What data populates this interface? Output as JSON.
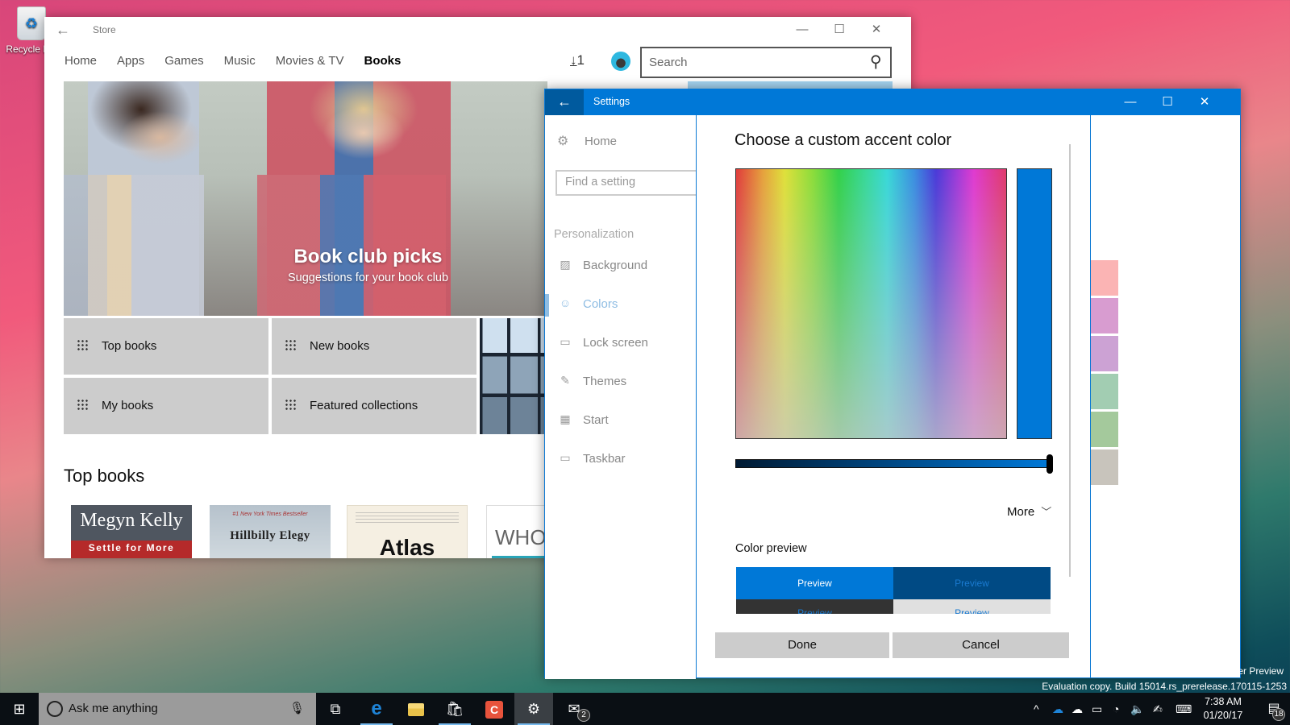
{
  "desktop": {
    "recycle_bin_label": "Recycle Bin",
    "watermark_line1": "Insider Preview",
    "watermark_line2": "Evaluation copy. Build 15014.rs_prerelease.170115-1253"
  },
  "store": {
    "title": "Store",
    "nav": [
      "Home",
      "Apps",
      "Games",
      "Music",
      "Movies & TV",
      "Books"
    ],
    "active_nav": "Books",
    "downloads_count": "1",
    "search_placeholder": "Search",
    "hero": {
      "title": "Book club picks",
      "subtitle": "Suggestions for your book club"
    },
    "tiles": [
      "Top books",
      "New books",
      "My books",
      "Featured collections"
    ],
    "section_title": "Top books",
    "books": [
      {
        "line1": "Megyn Kelly",
        "line2": "Settle for More"
      },
      {
        "line1": "#1 New York Times Bestseller",
        "line2": "Hillbilly Elegy"
      },
      {
        "line1": "",
        "line2": "Atlas"
      },
      {
        "line1": "",
        "line2": "WHO"
      }
    ]
  },
  "settings": {
    "title": "Settings",
    "home_label": "Home",
    "search_placeholder": "Find a setting",
    "group_label": "Personalization",
    "nav": [
      {
        "label": "Background",
        "icon": "image-icon"
      },
      {
        "label": "Colors",
        "icon": "palette-icon",
        "active": true
      },
      {
        "label": "Lock screen",
        "icon": "lock-screen-icon"
      },
      {
        "label": "Themes",
        "icon": "themes-icon"
      },
      {
        "label": "Start",
        "icon": "start-icon"
      },
      {
        "label": "Taskbar",
        "icon": "taskbar-icon"
      }
    ],
    "palette_colors": [
      "#fbb4b4",
      "#d89cd0",
      "#cca2d4",
      "#a2cdb2",
      "#a4c99c",
      "#c8c4bc"
    ]
  },
  "dialog": {
    "title": "Choose a custom accent color",
    "selected_color": "#0078d7",
    "brightness": 1.0,
    "more_label": "More",
    "color_preview_label": "Color preview",
    "preview_labels": [
      "Preview",
      "Preview",
      "Preview",
      "Preview"
    ],
    "done_label": "Done",
    "cancel_label": "Cancel"
  },
  "taskbar": {
    "search_placeholder": "Ask me anything",
    "mail_badge": "2",
    "time": "7:38 AM",
    "date": "01/20/17",
    "notification_count": "18"
  }
}
